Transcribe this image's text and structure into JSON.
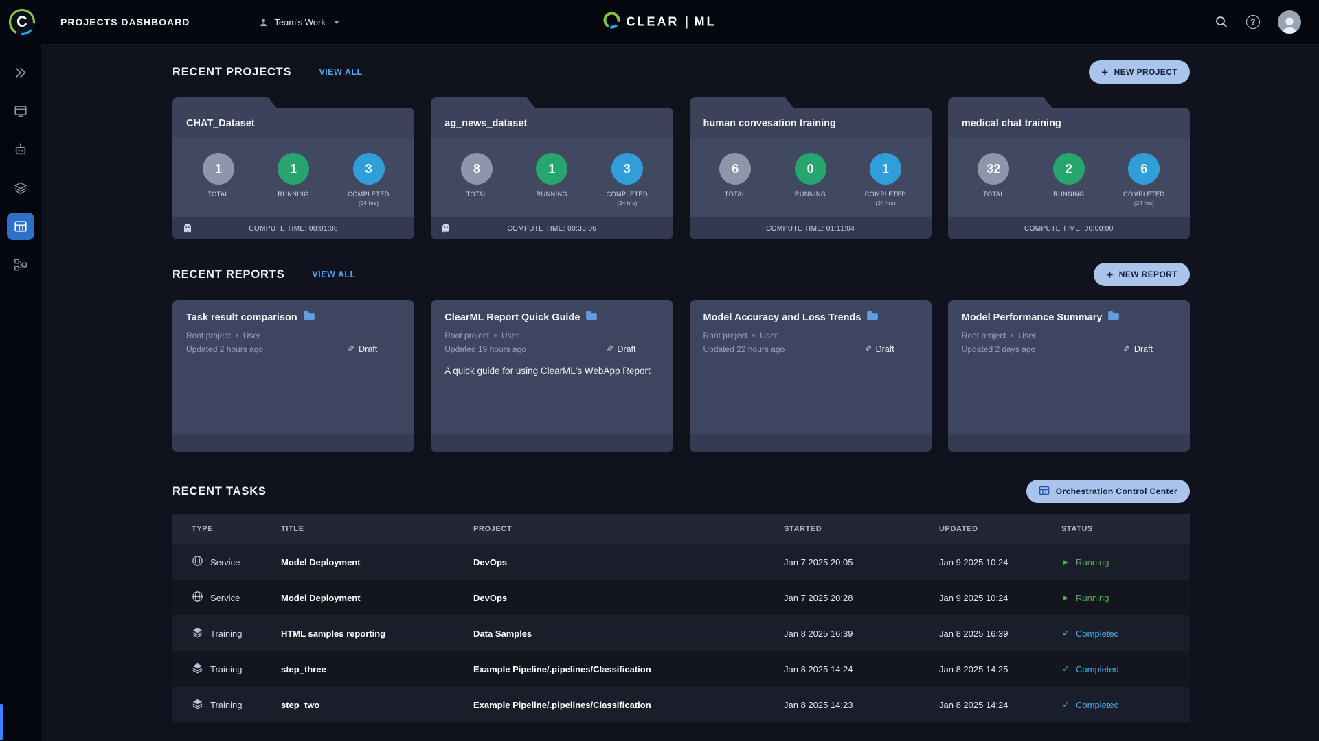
{
  "topbar": {
    "brand_letter": "C",
    "title": "PROJECTS DASHBOARD",
    "workspace": "Team's Work",
    "logo_clear": "CLEAR",
    "logo_ml": "ML",
    "help_glyph": "?"
  },
  "icons": {
    "brand": "clearml-c-swirl",
    "workspace": "person",
    "caret": "chevron-down",
    "search": "magnifier",
    "help": "question-mark-circle",
    "avatar": "person-circle",
    "sidebar": [
      "rocket",
      "screen",
      "robot",
      "layers",
      "grid-table",
      "pipelines"
    ],
    "ghost": "example-project-ghost",
    "report_folder": "blue-folder",
    "draft": "pencil",
    "service": "globe",
    "training": "layers",
    "orchestration": "grid",
    "status_running": "play-triangle",
    "status_completed": "check-mark"
  },
  "projects": {
    "heading": "RECENT PROJECTS",
    "view_all": "VIEW ALL",
    "new_label": "NEW PROJECT",
    "stat_labels": {
      "total": "TOTAL",
      "running": "RUNNING",
      "completed": "COMPLETED",
      "window": "(24 hrs)"
    },
    "cards": [
      {
        "name": "CHAT_Dataset",
        "total": "1",
        "running": "1",
        "completed": "3",
        "compute": "COMPUTE TIME: 00:01:08",
        "example": true
      },
      {
        "name": "ag_news_dataset",
        "total": "8",
        "running": "1",
        "completed": "3",
        "compute": "COMPUTE TIME: 00:33:06",
        "example": true
      },
      {
        "name": "human convesation training",
        "total": "6",
        "running": "0",
        "completed": "1",
        "compute": "COMPUTE TIME: 01:11:04",
        "example": false
      },
      {
        "name": "medical chat training",
        "total": "32",
        "running": "2",
        "completed": "6",
        "compute": "COMPUTE TIME: 00:00:00",
        "example": false
      }
    ]
  },
  "reports": {
    "heading": "RECENT REPORTS",
    "view_all": "VIEW ALL",
    "new_label": "NEW REPORT",
    "cards": [
      {
        "title": "Task result comparison",
        "project": "Root project",
        "author": "User",
        "updated": "Updated 2 hours ago",
        "badge": "Draft",
        "description": ""
      },
      {
        "title": "ClearML Report Quick Guide",
        "project": "Root project",
        "author": "User",
        "updated": "Updated 19 hours ago",
        "badge": "Draft",
        "description": "A quick guide for using ClearML's WebApp Report"
      },
      {
        "title": "Model Accuracy and Loss Trends",
        "project": "Root project",
        "author": "User",
        "updated": "Updated 22 hours ago",
        "badge": "Draft",
        "description": ""
      },
      {
        "title": "Model Performance Summary",
        "project": "Root project",
        "author": "User",
        "updated": "Updated 2 days ago",
        "badge": "Draft",
        "description": ""
      }
    ]
  },
  "tasks": {
    "heading": "RECENT TASKS",
    "occ_label": "Orchestration Control Center",
    "columns": [
      "TYPE",
      "TITLE",
      "PROJECT",
      "STARTED",
      "UPDATED",
      "STATUS"
    ],
    "rows": [
      {
        "type": "Service",
        "title": "Model Deployment",
        "project": "DevOps",
        "started": "Jan 7 2025 20:05",
        "updated": "Jan 9 2025 10:24",
        "status": "Running"
      },
      {
        "type": "Service",
        "title": "Model Deployment",
        "project": "DevOps",
        "started": "Jan 7 2025 20:28",
        "updated": "Jan 9 2025 10:24",
        "status": "Running"
      },
      {
        "type": "Training",
        "title": "HTML samples reporting",
        "project": "Data Samples",
        "started": "Jan 8 2025 16:39",
        "updated": "Jan 8 2025 16:39",
        "status": "Completed"
      },
      {
        "type": "Training",
        "title": "step_three",
        "project": "Example Pipeline/.pipelines/Classification",
        "started": "Jan 8 2025 14:24",
        "updated": "Jan 8 2025 14:25",
        "status": "Completed"
      },
      {
        "type": "Training",
        "title": "step_two",
        "project": "Example Pipeline/.pipelines/Classification",
        "started": "Jan 8 2025 14:23",
        "updated": "Jan 8 2025 14:24",
        "status": "Completed"
      }
    ]
  },
  "colors": {
    "page_bg": "#10131d",
    "topbar_bg": "#04070d",
    "card_bg": "#414961",
    "card_header_bg": "#3b425a",
    "card_footer_bg": "#333950",
    "report_bg": "#3e4560",
    "report_footer_bg": "#353b52",
    "table_header_bg": "#222733",
    "row_odd_bg": "#1a1e2a",
    "row_even_bg": "#13161f",
    "accent_link": "#4ba3f5",
    "button_bg": "#aac4ec",
    "button_text": "#132038",
    "circle_total": "#8e96ac",
    "circle_running": "#27a56f",
    "circle_completed": "#309fd9",
    "status_running": "#4caf50",
    "status_completed": "#45aee8",
    "sidebar_active": "#2e6fc9"
  }
}
